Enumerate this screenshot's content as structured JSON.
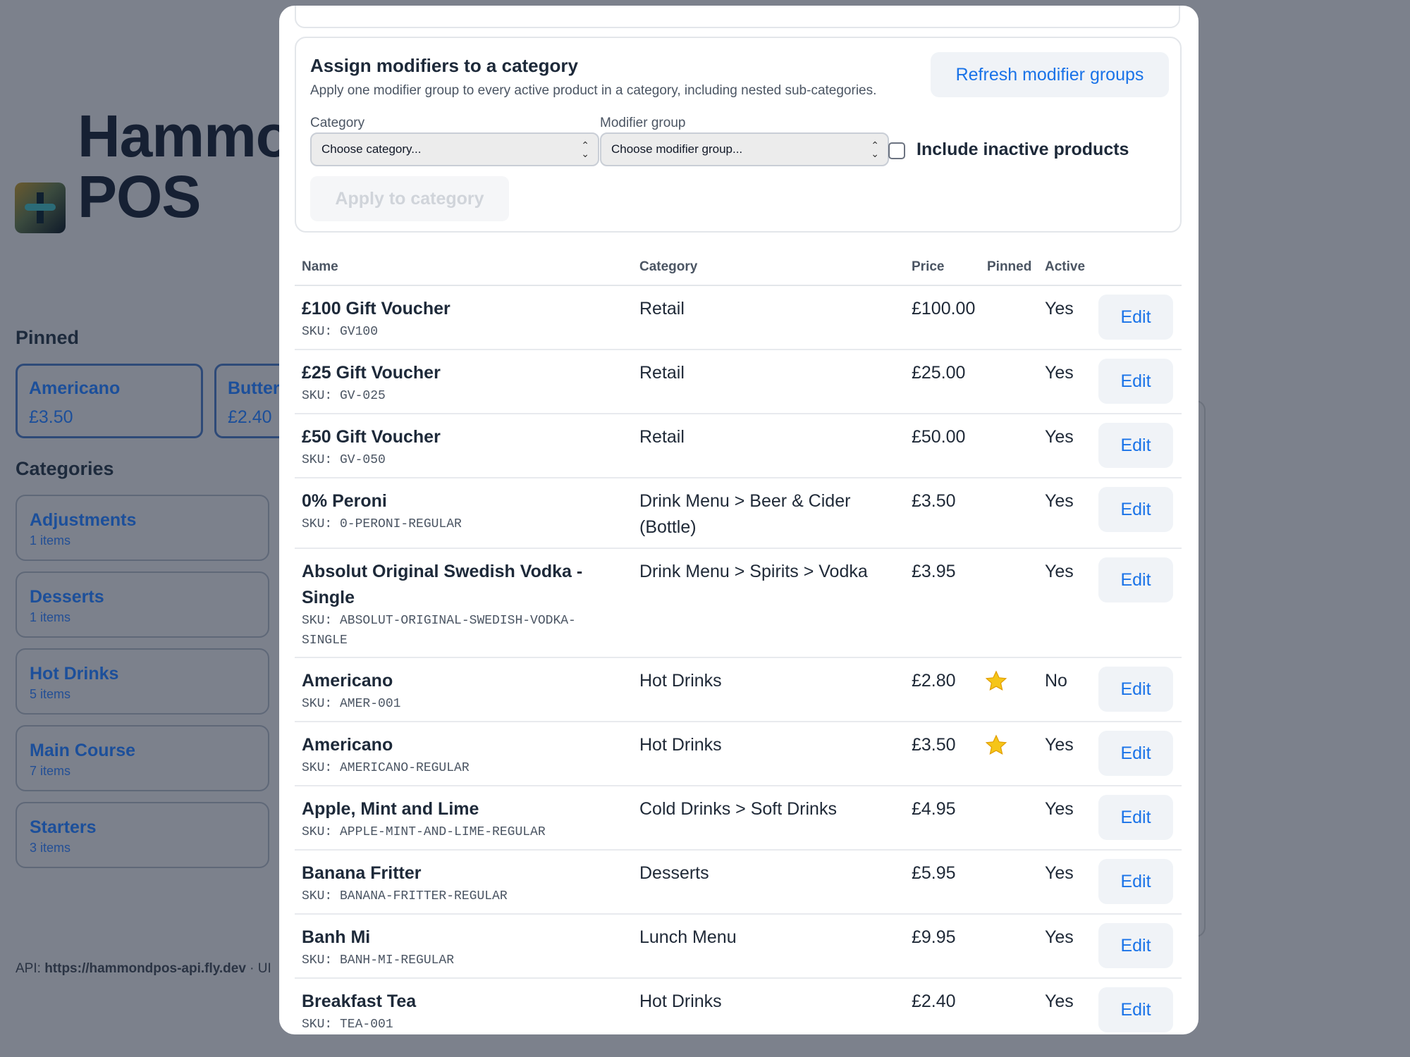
{
  "background": {
    "app_title_line1": "Hammo",
    "app_title_line2": "POS",
    "pinned_heading": "Pinned",
    "pinned": [
      {
        "name": "Americano",
        "price": "£3.50"
      },
      {
        "name": "Butter",
        "price": "£2.40"
      }
    ],
    "categories_heading": "Categories",
    "categories": [
      {
        "name": "Adjustments",
        "count": "1 items"
      },
      {
        "name": "Desserts",
        "count": "1 items"
      },
      {
        "name": "Hot Drinks",
        "count": "5 items"
      },
      {
        "name": "Main Course",
        "count": "7 items"
      },
      {
        "name": "Starters",
        "count": "3 items"
      }
    ],
    "footer_prefix": "API: ",
    "footer_api": "https://hammondpos-api.fly.dev",
    "footer_suffix": " · UI"
  },
  "assign": {
    "title": "Assign modifiers to a category",
    "subtitle": "Apply one modifier group to every active product in a category, including nested sub-categories.",
    "refresh_label": "Refresh modifier groups",
    "category_label": "Category",
    "category_value": "Choose category...",
    "modifier_label": "Modifier group",
    "modifier_value": "Choose modifier group...",
    "include_inactive_label": "Include inactive products",
    "include_inactive_checked": false,
    "apply_label": "Apply to category"
  },
  "table": {
    "headers": {
      "name": "Name",
      "category": "Category",
      "price": "Price",
      "pinned": "Pinned",
      "active": "Active"
    },
    "edit_label": "Edit",
    "rows": [
      {
        "name": "£100 Gift Voucher",
        "sku": "SKU: GV100",
        "category": "Retail",
        "price": "£100.00",
        "pinned": false,
        "active": "Yes"
      },
      {
        "name": "£25 Gift Voucher",
        "sku": "SKU: GV-025",
        "category": "Retail",
        "price": "£25.00",
        "pinned": false,
        "active": "Yes"
      },
      {
        "name": "£50 Gift Voucher",
        "sku": "SKU: GV-050",
        "category": "Retail",
        "price": "£50.00",
        "pinned": false,
        "active": "Yes"
      },
      {
        "name": "0% Peroni",
        "sku": "SKU: 0-PERONI-REGULAR",
        "category": "Drink Menu > Beer & Cider (Bottle)",
        "price": "£3.50",
        "pinned": false,
        "active": "Yes"
      },
      {
        "name": "Absolut Original Swedish Vodka - Single",
        "sku": "SKU: ABSOLUT-ORIGINAL-SWEDISH-VODKA-SINGLE",
        "category": "Drink Menu > Spirits > Vodka",
        "price": "£3.95",
        "pinned": false,
        "active": "Yes"
      },
      {
        "name": "Americano",
        "sku": "SKU: AMER-001",
        "category": "Hot Drinks",
        "price": "£2.80",
        "pinned": true,
        "active": "No"
      },
      {
        "name": "Americano",
        "sku": "SKU: AMERICANO-REGULAR",
        "category": "Hot Drinks",
        "price": "£3.50",
        "pinned": true,
        "active": "Yes"
      },
      {
        "name": "Apple, Mint and Lime",
        "sku": "SKU: APPLE-MINT-AND-LIME-REGULAR",
        "category": "Cold Drinks > Soft Drinks",
        "price": "£4.95",
        "pinned": false,
        "active": "Yes"
      },
      {
        "name": "Banana Fritter",
        "sku": "SKU: BANANA-FRITTER-REGULAR",
        "category": "Desserts",
        "price": "£5.95",
        "pinned": false,
        "active": "Yes"
      },
      {
        "name": "Banh Mi",
        "sku": "SKU: BANH-MI-REGULAR",
        "category": "Lunch Menu",
        "price": "£9.95",
        "pinned": false,
        "active": "Yes"
      },
      {
        "name": "Breakfast Tea",
        "sku": "SKU: TEA-001",
        "category": "Hot Drinks",
        "price": "£2.40",
        "pinned": false,
        "active": "Yes"
      }
    ]
  },
  "colors": {
    "accent": "#1a73e8",
    "overlay": "#7c818c",
    "star": "#f5c518"
  }
}
